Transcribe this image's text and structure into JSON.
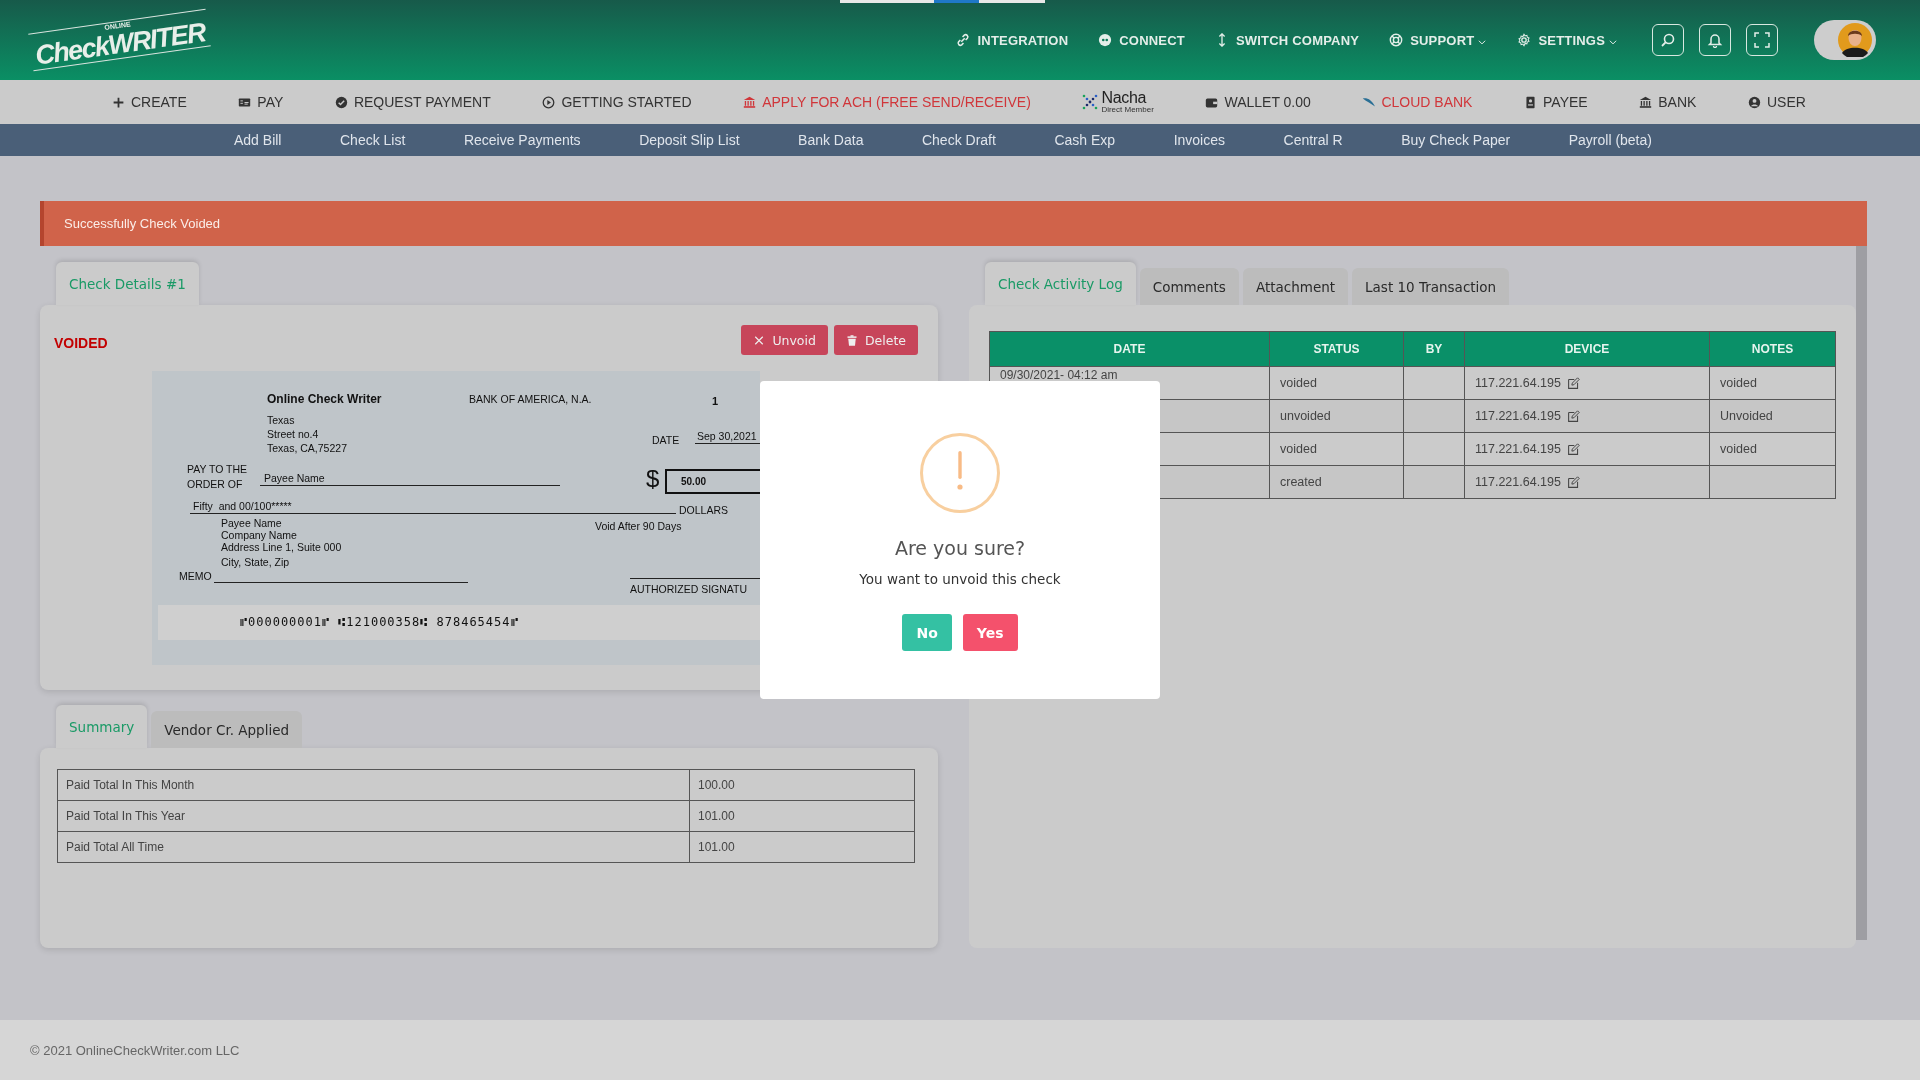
{
  "header": {
    "logo": {
      "small": "ONLINE",
      "main": "CheckWRITER"
    },
    "nav": [
      {
        "label": "INTEGRATION",
        "dropdown": false
      },
      {
        "label": "CONNECT",
        "dropdown": false
      },
      {
        "label": "SWITCH COMPANY",
        "dropdown": false
      },
      {
        "label": "SUPPORT",
        "dropdown": true
      },
      {
        "label": "SETTINGS",
        "dropdown": true
      }
    ]
  },
  "menu": [
    {
      "label": "CREATE",
      "kind": "link",
      "highlight": false
    },
    {
      "label": "PAY",
      "kind": "link",
      "highlight": false
    },
    {
      "label": "REQUEST PAYMENT",
      "kind": "link",
      "highlight": false
    },
    {
      "label": "GETTING STARTED",
      "kind": "link",
      "highlight": false
    },
    {
      "label": "APPLY FOR ACH (FREE SEND/RECEIVE)",
      "kind": "link",
      "highlight": true
    },
    {
      "label": "Nacha",
      "sublabel": "Direct Member",
      "kind": "logo"
    },
    {
      "label": "WALLET 0.00",
      "kind": "link",
      "highlight": false
    },
    {
      "label": "CLOUD BANK",
      "kind": "link",
      "highlight": true
    },
    {
      "label": "PAYEE",
      "kind": "link",
      "highlight": false
    },
    {
      "label": "BANK",
      "kind": "link",
      "highlight": false
    },
    {
      "label": "USER",
      "kind": "link",
      "highlight": false
    }
  ],
  "subnav": [
    "Add Bill",
    "Check List",
    "Receive Payments",
    "Deposit Slip List",
    "Bank Data",
    "Check Draft",
    "Cash Exp",
    "Invoices",
    "Central R",
    "Buy Check Paper",
    "Payroll (beta)"
  ],
  "alert": {
    "message": "Successfully Check Voided"
  },
  "check_panel": {
    "tabs": [
      {
        "label": "Check Details #1",
        "selected": true
      }
    ],
    "status": "VOIDED",
    "buttons": [
      {
        "label": "Unvoid",
        "kind": "unvoid"
      },
      {
        "label": "Delete",
        "kind": "delete"
      }
    ],
    "check": {
      "company_name": "Online Check Writer",
      "company_address": [
        "Texas",
        "Street no.4",
        "Texas, CA,75227"
      ],
      "bank": "BANK OF AMERICA, N.A.",
      "number": "1",
      "date_label": "DATE",
      "date": "Sep 30,2021",
      "pay_to_label": [
        "PAY TO THE",
        "ORDER OF"
      ],
      "payee": "Payee Name",
      "currency": "$",
      "amount": "50.00",
      "amount_words": "Fifty  and 00/100*****",
      "dollars_label": "DOLLARS",
      "payee_address": [
        "Payee Name",
        "Company Name",
        "Address Line 1, Suite 000",
        "City, State, Zip"
      ],
      "void_note": "Void After 90 Days",
      "memo_label": "MEMO",
      "signature_label": "AUTHORIZED SIGNATU",
      "micr": "⑈000000001⑈ ⑆121000358⑆ 878465454⑈"
    }
  },
  "summary_panel": {
    "tabs": [
      {
        "label": "Summary",
        "selected": true
      },
      {
        "label": "Vendor Cr. Applied",
        "selected": false
      }
    ],
    "rows": [
      {
        "label": "Paid Total In This Month",
        "value": "100.00"
      },
      {
        "label": "Paid Total In This Year",
        "value": "101.00"
      },
      {
        "label": "Paid Total All Time",
        "value": "101.00"
      }
    ]
  },
  "activity_panel": {
    "tabs": [
      {
        "label": "Check Activity Log",
        "selected": true
      },
      {
        "label": "Comments",
        "selected": false
      },
      {
        "label": "Attachment",
        "selected": false
      },
      {
        "label": "Last 10 Transaction",
        "selected": false
      }
    ],
    "columns": [
      "DATE",
      "STATUS",
      "BY",
      "DEVICE",
      "NOTES"
    ],
    "rows": [
      {
        "date": "09/30/2021- 04:12 am",
        "status": "voided",
        "device": "117.221.64.195",
        "notes": "voided"
      },
      {
        "status": "unvoided",
        "device": "117.221.64.195",
        "notes": "Unvoided"
      },
      {
        "status": "voided",
        "device": "117.221.64.195",
        "notes": "voided"
      },
      {
        "status": "created",
        "device": "117.221.64.195"
      }
    ]
  },
  "modal": {
    "title": "Are you sure?",
    "message": "You want to unvoid this check",
    "buttons": [
      {
        "label": "No",
        "kind": "cancel"
      },
      {
        "label": "Yes",
        "kind": "confirm"
      }
    ]
  },
  "footer": {
    "text": "© 2021 OnlineCheckWriter.com LLC"
  }
}
